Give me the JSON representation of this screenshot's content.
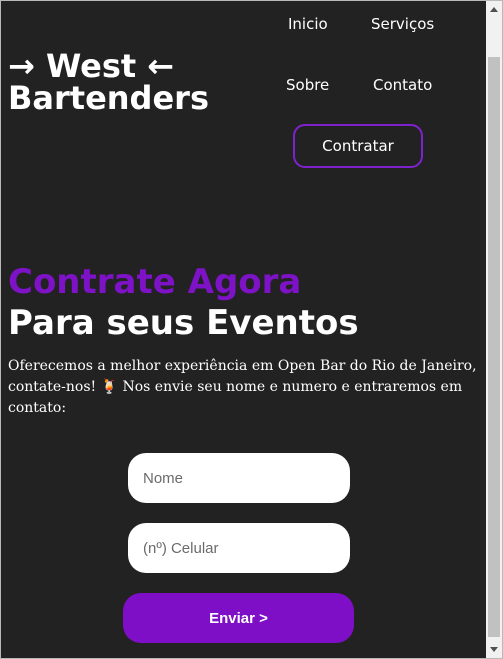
{
  "header": {
    "logo_line1": "→ West ←",
    "logo_line2": "Bartenders",
    "nav": {
      "inicio": "Inicio",
      "servicos": "Serviços",
      "sobre": "Sobre",
      "contato": "Contato"
    },
    "cta_label": "Contratar"
  },
  "hero": {
    "title_accent": "Contrate Agora",
    "title_main": "Para seus Eventos",
    "description": "Oferecemos a melhor experiência em Open Bar do Rio de Janeiro, contate-nos! 🍹 Nos envie seu nome e numero e entraremos em contato:"
  },
  "form": {
    "name_placeholder": "Nome",
    "phone_placeholder": "(nº) Celular",
    "submit_label": "Enviar >"
  },
  "colors": {
    "background": "#222222",
    "accent": "#7e12c7",
    "text": "#ffffff"
  }
}
